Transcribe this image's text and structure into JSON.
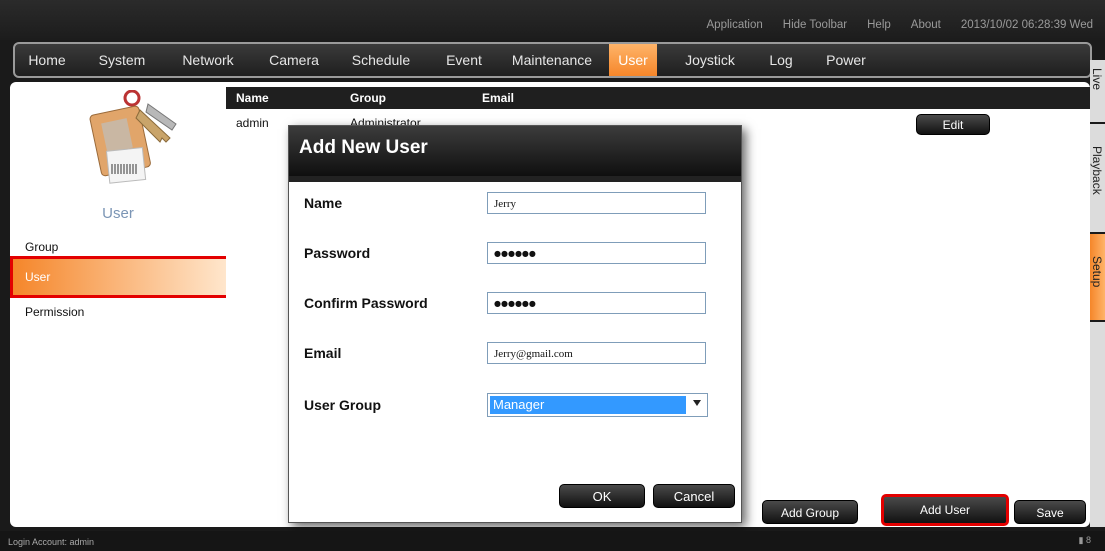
{
  "toolbar": {
    "items": [
      "Application",
      "Hide Toolbar",
      "Help",
      "About"
    ],
    "datetime": "2013/10/02 06:28:39 Wed"
  },
  "menu": {
    "items": [
      "Home",
      "System",
      "Network",
      "Camera",
      "Schedule",
      "Event",
      "Maintenance",
      "User",
      "Joystick",
      "Log",
      "Power"
    ],
    "active": "User"
  },
  "side_tabs": [
    "Live",
    "Playback",
    "Setup"
  ],
  "left": {
    "title": "User",
    "items": [
      "Group",
      "User",
      "Permission"
    ]
  },
  "table": {
    "headers": [
      "Name",
      "Group",
      "Email"
    ],
    "rows": [
      {
        "name": "admin",
        "group": "Administrator",
        "email": ""
      }
    ],
    "edit_label": "Edit"
  },
  "dialog": {
    "title": "Add New User",
    "fields": {
      "name": {
        "label": "Name",
        "value": "Jerry"
      },
      "password": {
        "label": "Password",
        "value": "●●●●●●"
      },
      "confirm": {
        "label": "Confirm Password",
        "value": "●●●●●●"
      },
      "email": {
        "label": "Email",
        "value": "Jerry@gmail.com"
      },
      "group": {
        "label": "User Group",
        "value": "Manager"
      }
    },
    "ok_label": "OK",
    "cancel_label": "Cancel"
  },
  "buttons": {
    "add_group": "Add Group",
    "add_user": "Add User",
    "save": "Save"
  },
  "status": {
    "login": "Login Account: admin",
    "right": "8"
  },
  "colors": {
    "accent": "#f5862a",
    "highlight": "#e30000"
  }
}
